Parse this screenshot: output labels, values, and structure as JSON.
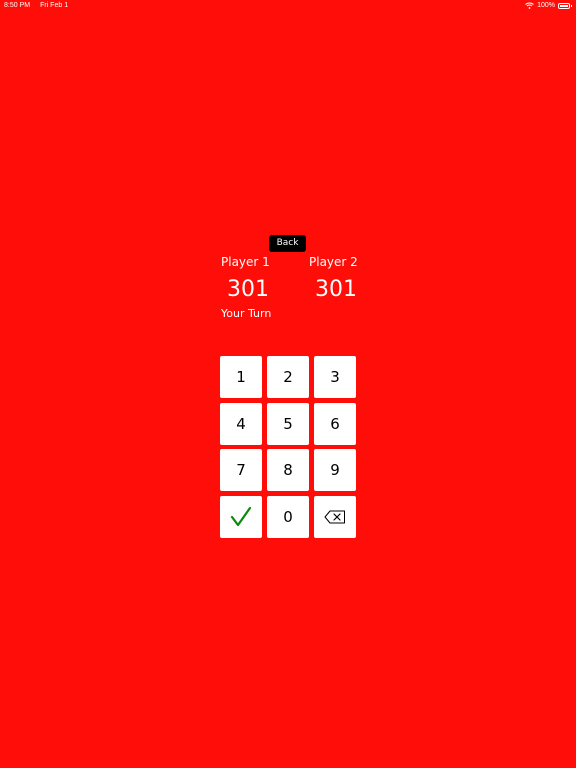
{
  "status_bar": {
    "time": "8:50 PM",
    "date": "Fri Feb 1",
    "battery": "100%",
    "icons": [
      "wifi-icon",
      "battery-icon"
    ]
  },
  "back_button": {
    "label": "Back"
  },
  "players": [
    {
      "name": "Player 1",
      "score": "301"
    },
    {
      "name": "Player 2",
      "score": "301"
    }
  ],
  "turn_label": "Your Turn",
  "keypad": {
    "keys": [
      "1",
      "2",
      "3",
      "4",
      "5",
      "6",
      "7",
      "8",
      "9",
      "0"
    ],
    "confirm_icon": "checkmark-icon",
    "delete_icon": "backspace-icon",
    "confirm_color": "#0b8a0b"
  },
  "colors": {
    "background": "#ff0d08",
    "key_background": "#ffffff",
    "back_button_background": "#000000"
  }
}
